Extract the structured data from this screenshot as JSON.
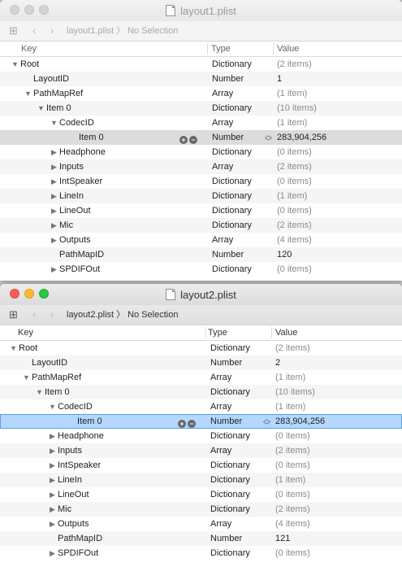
{
  "windows": [
    {
      "title": "layout1.plist",
      "path": {
        "file": "layout1.plist",
        "selection": "No Selection"
      },
      "columns": {
        "key": "Key",
        "type": "Type",
        "value": "Value"
      },
      "rows": [
        {
          "level": 0,
          "disclosure": "open",
          "key": "Root",
          "type": "Dictionary",
          "value": "(2 items)",
          "muted": true
        },
        {
          "level": 1,
          "disclosure": "none",
          "key": "LayoutID",
          "type": "Number",
          "value": "1",
          "muted": false
        },
        {
          "level": 1,
          "disclosure": "open",
          "key": "PathMapRef",
          "type": "Array",
          "value": "(1 item)",
          "muted": true
        },
        {
          "level": 2,
          "disclosure": "open",
          "key": "Item 0",
          "type": "Dictionary",
          "value": "(10 items)",
          "muted": true
        },
        {
          "level": 3,
          "disclosure": "open",
          "key": "CodecID",
          "type": "Array",
          "value": "(1 item)",
          "muted": true
        },
        {
          "level": 4,
          "disclosure": "none",
          "key": "Item 0",
          "type": "Number",
          "value": "283,904,256",
          "muted": false,
          "selected": "grey"
        },
        {
          "level": 3,
          "disclosure": "closed",
          "key": "Headphone",
          "type": "Dictionary",
          "value": "(0 items)",
          "muted": true
        },
        {
          "level": 3,
          "disclosure": "closed",
          "key": "Inputs",
          "type": "Array",
          "value": "(2 items)",
          "muted": true
        },
        {
          "level": 3,
          "disclosure": "closed",
          "key": "IntSpeaker",
          "type": "Dictionary",
          "value": "(0 items)",
          "muted": true
        },
        {
          "level": 3,
          "disclosure": "closed",
          "key": "LineIn",
          "type": "Dictionary",
          "value": "(1 item)",
          "muted": true
        },
        {
          "level": 3,
          "disclosure": "closed",
          "key": "LineOut",
          "type": "Dictionary",
          "value": "(0 items)",
          "muted": true
        },
        {
          "level": 3,
          "disclosure": "closed",
          "key": "Mic",
          "type": "Dictionary",
          "value": "(2 items)",
          "muted": true
        },
        {
          "level": 3,
          "disclosure": "closed",
          "key": "Outputs",
          "type": "Array",
          "value": "(4 items)",
          "muted": true
        },
        {
          "level": 3,
          "disclosure": "none",
          "key": "PathMapID",
          "type": "Number",
          "value": "120",
          "muted": false
        },
        {
          "level": 3,
          "disclosure": "closed",
          "key": "SPDIFOut",
          "type": "Dictionary",
          "value": "(0 items)",
          "muted": true
        }
      ]
    },
    {
      "title": "layout2.plist",
      "path": {
        "file": "layout2.plist",
        "selection": "No Selection"
      },
      "columns": {
        "key": "Key",
        "type": "Type",
        "value": "Value"
      },
      "rows": [
        {
          "level": 0,
          "disclosure": "open",
          "key": "Root",
          "type": "Dictionary",
          "value": "(2 items)",
          "muted": true
        },
        {
          "level": 1,
          "disclosure": "none",
          "key": "LayoutID",
          "type": "Number",
          "value": "2",
          "muted": false
        },
        {
          "level": 1,
          "disclosure": "open",
          "key": "PathMapRef",
          "type": "Array",
          "value": "(1 item)",
          "muted": true
        },
        {
          "level": 2,
          "disclosure": "open",
          "key": "Item 0",
          "type": "Dictionary",
          "value": "(10 items)",
          "muted": true
        },
        {
          "level": 3,
          "disclosure": "open",
          "key": "CodecID",
          "type": "Array",
          "value": "(1 item)",
          "muted": true
        },
        {
          "level": 4,
          "disclosure": "none",
          "key": "Item 0",
          "type": "Number",
          "value": "283,904,256",
          "muted": false,
          "selected": "blue"
        },
        {
          "level": 3,
          "disclosure": "closed",
          "key": "Headphone",
          "type": "Dictionary",
          "value": "(0 items)",
          "muted": true
        },
        {
          "level": 3,
          "disclosure": "closed",
          "key": "Inputs",
          "type": "Array",
          "value": "(2 items)",
          "muted": true
        },
        {
          "level": 3,
          "disclosure": "closed",
          "key": "IntSpeaker",
          "type": "Dictionary",
          "value": "(0 items)",
          "muted": true
        },
        {
          "level": 3,
          "disclosure": "closed",
          "key": "LineIn",
          "type": "Dictionary",
          "value": "(1 item)",
          "muted": true
        },
        {
          "level": 3,
          "disclosure": "closed",
          "key": "LineOut",
          "type": "Dictionary",
          "value": "(0 items)",
          "muted": true
        },
        {
          "level": 3,
          "disclosure": "closed",
          "key": "Mic",
          "type": "Dictionary",
          "value": "(2 items)",
          "muted": true
        },
        {
          "level": 3,
          "disclosure": "closed",
          "key": "Outputs",
          "type": "Array",
          "value": "(4 items)",
          "muted": true
        },
        {
          "level": 3,
          "disclosure": "none",
          "key": "PathMapID",
          "type": "Number",
          "value": "121",
          "muted": false
        },
        {
          "level": 3,
          "disclosure": "closed",
          "key": "SPDIFOut",
          "type": "Dictionary",
          "value": "(0 items)",
          "muted": true
        }
      ]
    }
  ],
  "icons": {
    "grid": "grid-icon",
    "back": "chevron-left-icon",
    "forward": "chevron-right-icon",
    "add": "plus-circle-icon",
    "remove": "minus-circle-icon",
    "stepper": "stepper-icon"
  },
  "colors": {
    "selection_blue": "#b3d7ff",
    "selection_grey": "#dcdcdc",
    "close": "#fc5f57",
    "minimize": "#fdbc2e",
    "maximize": "#28c840"
  }
}
